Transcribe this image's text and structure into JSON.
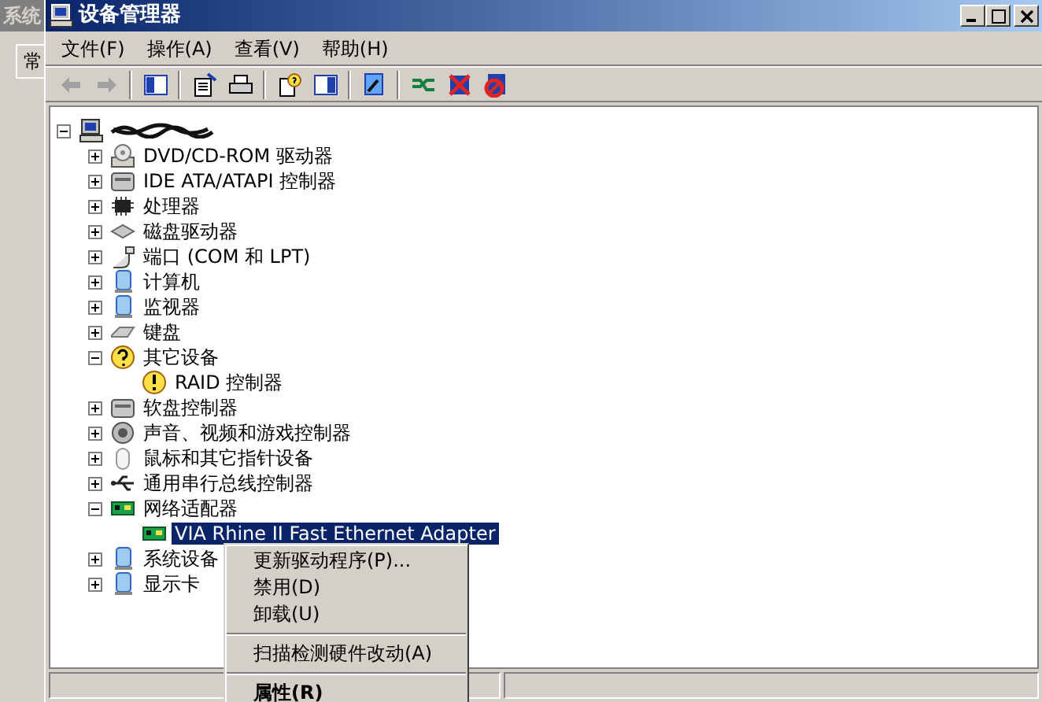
{
  "background_window": {
    "title": "系统",
    "tab": "常"
  },
  "window": {
    "title": "设备管理器"
  },
  "menu_bar": [
    {
      "label": "文件(F)"
    },
    {
      "label": "操作(A)"
    },
    {
      "label": "查看(V)"
    },
    {
      "label": "帮助(H)"
    }
  ],
  "toolbar": [
    {
      "kind": "back",
      "disabled": true
    },
    {
      "kind": "forward",
      "disabled": true
    },
    {
      "kind": "sep"
    },
    {
      "kind": "tree"
    },
    {
      "kind": "sep"
    },
    {
      "kind": "properties"
    },
    {
      "kind": "print"
    },
    {
      "kind": "sep"
    },
    {
      "kind": "help"
    },
    {
      "kind": "pane"
    },
    {
      "kind": "sep"
    },
    {
      "kind": "scan"
    },
    {
      "kind": "sep"
    },
    {
      "kind": "update"
    },
    {
      "kind": "disable"
    },
    {
      "kind": "uninstall"
    }
  ],
  "tree": {
    "kind": "computer",
    "expanded": true,
    "children": [
      {
        "label": "DVD/CD-ROM 驱动器",
        "kind": "disc",
        "expanded": false,
        "selected": false
      },
      {
        "label": "IDE ATA/ATAPI 控制器",
        "kind": "drive",
        "expanded": false,
        "selected": false
      },
      {
        "label": "处理器",
        "kind": "chip",
        "expanded": false,
        "selected": false
      },
      {
        "label": "磁盘驱动器",
        "kind": "disk",
        "expanded": false,
        "selected": false
      },
      {
        "label": "端口 (COM 和 LPT)",
        "kind": "port",
        "expanded": false,
        "selected": false
      },
      {
        "label": "计算机",
        "kind": "monitor",
        "expanded": false,
        "selected": false
      },
      {
        "label": "监视器",
        "kind": "monitor",
        "expanded": false,
        "selected": false
      },
      {
        "label": "键盘",
        "kind": "keyboard",
        "expanded": false,
        "selected": false
      },
      {
        "label": "其它设备",
        "kind": "unknown",
        "expanded": true,
        "selected": false,
        "children": [
          {
            "label": "RAID 控制器",
            "kind": "warning",
            "selected": false
          }
        ]
      },
      {
        "label": "软盘控制器",
        "kind": "drive",
        "expanded": false,
        "selected": false
      },
      {
        "label": "声音、视频和游戏控制器",
        "kind": "sound",
        "expanded": false,
        "selected": false
      },
      {
        "label": "鼠标和其它指针设备",
        "kind": "mouse",
        "expanded": false,
        "selected": false
      },
      {
        "label": "通用串行总线控制器",
        "kind": "usb",
        "expanded": false,
        "selected": false
      },
      {
        "label": "网络适配器",
        "kind": "network",
        "expanded": true,
        "selected": false,
        "children": [
          {
            "label": "VIA Rhine II Fast Ethernet Adapter",
            "kind": "network",
            "selected": true
          }
        ]
      },
      {
        "label": "系统设备",
        "kind": "monitor",
        "expanded": false,
        "selected": false
      },
      {
        "label": "显示卡",
        "kind": "monitor",
        "expanded": false,
        "selected": false
      }
    ]
  },
  "context_menu": [
    {
      "kind": "item",
      "label": "更新驱动程序(P)...",
      "default": false
    },
    {
      "kind": "item",
      "label": "禁用(D)",
      "default": false
    },
    {
      "kind": "item",
      "label": "卸载(U)",
      "default": false
    },
    {
      "kind": "separator"
    },
    {
      "kind": "item",
      "label": "扫描检测硬件改动(A)",
      "default": false
    },
    {
      "kind": "separator"
    },
    {
      "kind": "item",
      "label": "属性(R)",
      "default": true
    }
  ]
}
